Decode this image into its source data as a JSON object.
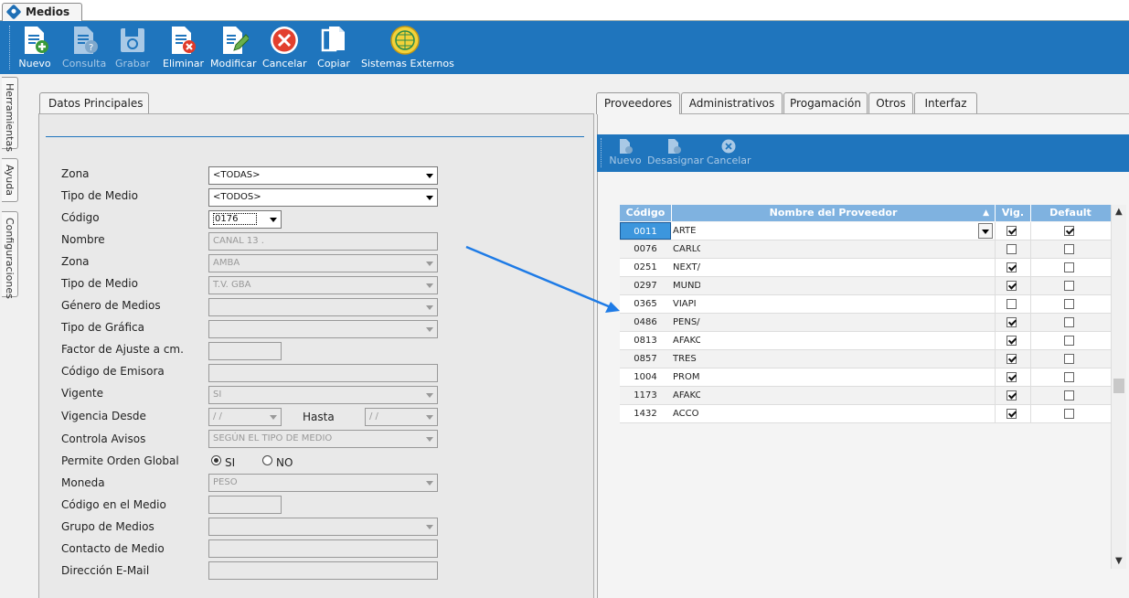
{
  "doc_tab": {
    "title": "Medios"
  },
  "toolbar": {
    "buttons": [
      {
        "label": "Nuevo",
        "enabled": true
      },
      {
        "label": "Consulta",
        "enabled": false
      },
      {
        "label": "Grabar",
        "enabled": false
      },
      {
        "label": "Eliminar",
        "enabled": true
      },
      {
        "label": "Modificar",
        "enabled": true
      },
      {
        "label": "Cancelar",
        "enabled": true
      },
      {
        "label": "Copiar",
        "enabled": true
      },
      {
        "label": "Sistemas Externos",
        "enabled": true
      }
    ]
  },
  "side_tabs": [
    "Herramientas",
    "Ayuda",
    "Configuraciones"
  ],
  "left": {
    "tab": "Datos Principales",
    "labels": {
      "zona": "Zona",
      "tipo_medio": "Tipo de Medio",
      "codigo": "Código",
      "nombre": "Nombre",
      "zona2": "Zona",
      "tipo_medio2": "Tipo de Medio",
      "genero": "Género de Medios",
      "tipo_grafica": "Tipo de Gráfica",
      "factor": "Factor de Ajuste a cm.",
      "cod_emisora": "Código de Emisora",
      "vigente": "Vigente",
      "vig_desde": "Vigencia Desde",
      "hasta": "Hasta",
      "controla": "Controla Avisos",
      "permite": "Permite Orden Global",
      "moneda": "Moneda",
      "cod_medio": "Código en el Medio",
      "grupo": "Grupo de Medios",
      "contacto": "Contacto de Medio",
      "email": "Dirección E-Mail"
    },
    "values": {
      "zona": "<TODAS>",
      "tipo_medio": "<TODOS>",
      "codigo": "0176",
      "nombre": "CANAL 13 .",
      "zona2": "AMBA",
      "tipo_medio2": "T.V. GBA",
      "vigente": "SI",
      "vig_desde": " /  /",
      "hasta": " /  /",
      "controla": "SEGÚN EL TIPO DE MEDIO",
      "moneda": "PESO"
    },
    "radio": {
      "si": "SI",
      "no": "NO",
      "selected": "SI"
    }
  },
  "right": {
    "tabs": [
      "Proveedores",
      "Administrativos",
      "Progamación",
      "Otros",
      "Interfaz"
    ],
    "active_tab": "Proveedores",
    "sub_toolbar": [
      "Nuevo",
      "Desasignar",
      "Cancelar"
    ],
    "grid": {
      "headers": [
        "Código",
        "Nombre del Proveedor",
        "Vig.",
        "Default"
      ],
      "rows": [
        {
          "codigo": "0011",
          "nombre": "ARTE",
          "vig": true,
          "default": true
        },
        {
          "codigo": "0076",
          "nombre": "CARLO",
          "vig": false,
          "default": false
        },
        {
          "codigo": "0251",
          "nombre": "NEXT/",
          "vig": true,
          "default": false
        },
        {
          "codigo": "0297",
          "nombre": "MUND",
          "vig": true,
          "default": false
        },
        {
          "codigo": "0365",
          "nombre": "VIAPI",
          "vig": false,
          "default": false
        },
        {
          "codigo": "0486",
          "nombre": "PENS/",
          "vig": true,
          "default": false
        },
        {
          "codigo": "0813",
          "nombre": "AFAKC",
          "vig": true,
          "default": false
        },
        {
          "codigo": "0857",
          "nombre": "TRES",
          "vig": true,
          "default": false
        },
        {
          "codigo": "1004",
          "nombre": "PROM",
          "vig": true,
          "default": false
        },
        {
          "codigo": "1173",
          "nombre": "AFAKC",
          "vig": true,
          "default": false
        },
        {
          "codigo": "1432",
          "nombre": "ACCO",
          "vig": true,
          "default": false
        }
      ]
    }
  },
  "colors": {
    "toolbar": "#1f75bd",
    "grid_header": "#7fb2e0",
    "arrow": "#1e7be6"
  }
}
